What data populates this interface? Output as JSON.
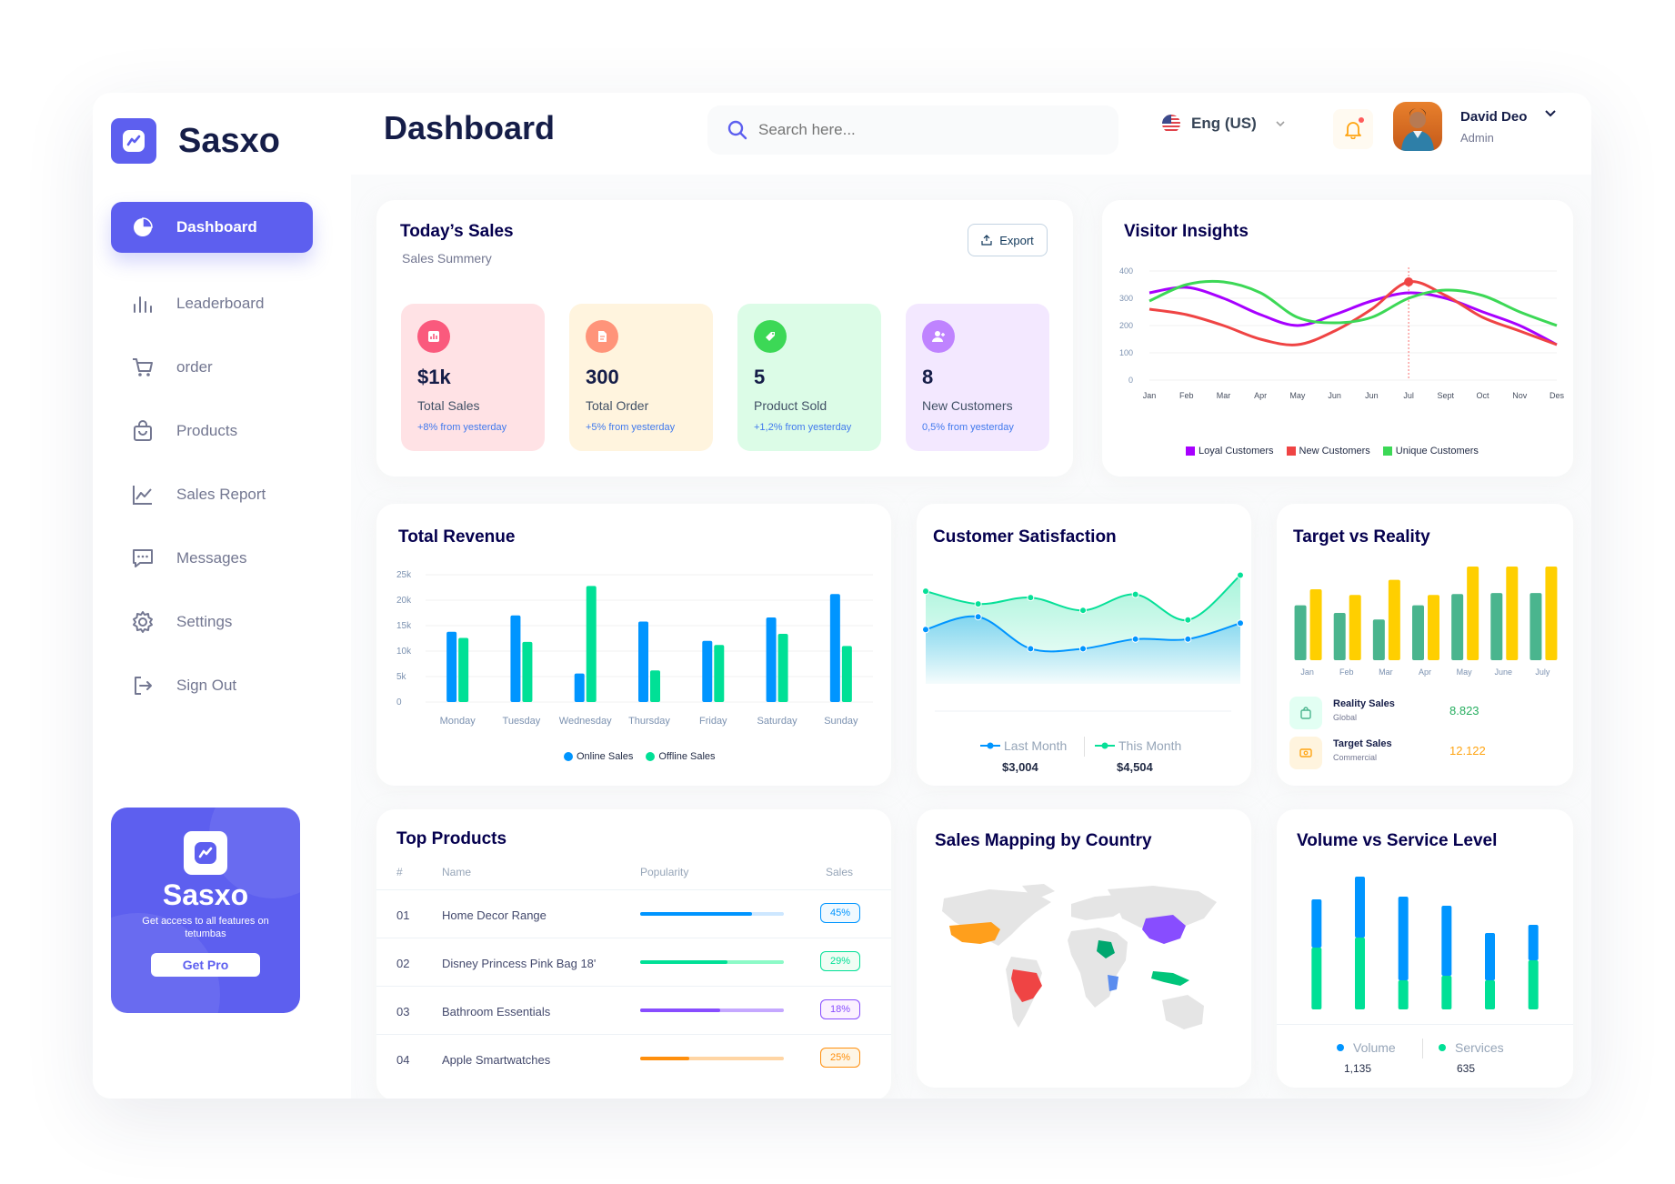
{
  "brand": {
    "name": "Sasxo"
  },
  "header": {
    "title": "Dashboard",
    "search_placeholder": "Search here...",
    "language": "Eng (US)",
    "user_name": "David Deo",
    "user_role": "Admin"
  },
  "sidebar": {
    "items": [
      {
        "label": "Dashboard",
        "icon": "pie-chart-icon",
        "active": true
      },
      {
        "label": "Leaderboard",
        "icon": "bar-chart-icon"
      },
      {
        "label": "order",
        "icon": "cart-icon"
      },
      {
        "label": "Products",
        "icon": "shopping-bag-icon"
      },
      {
        "label": "Sales Report",
        "icon": "line-chart-icon"
      },
      {
        "label": "Messages",
        "icon": "message-icon"
      },
      {
        "label": "Settings",
        "icon": "gear-icon"
      },
      {
        "label": "Sign Out",
        "icon": "sign-out-icon"
      }
    ],
    "promo": {
      "title": "Sasxo",
      "description": "Get access to all features on tetumbas",
      "button": "Get Pro"
    }
  },
  "todays_sales": {
    "title": "Today’s Sales",
    "subtitle": "Sales Summery",
    "export": "Export",
    "stats": [
      {
        "value": "$1k",
        "label": "Total Sales",
        "change": "+8% from yesterday",
        "bg": "#ffe2e5",
        "icon_bg": "#fa5a7d"
      },
      {
        "value": "300",
        "label": "Total Order",
        "change": "+5% from yesterday",
        "bg": "#fff4de",
        "icon_bg": "#ff947a"
      },
      {
        "value": "5",
        "label": "Product Sold",
        "change": "+1,2% from yesterday",
        "bg": "#dcfce7",
        "icon_bg": "#3cd856"
      },
      {
        "value": "8",
        "label": "New Customers",
        "change": "0,5% from yesterday",
        "bg": "#f3e8ff",
        "icon_bg": "#bf83ff"
      }
    ]
  },
  "visitor_insights": {
    "title": "Visitor Insights",
    "chart_data": {
      "type": "line",
      "x": [
        "Jan",
        "Feb",
        "Mar",
        "Apr",
        "May",
        "Jun",
        "Jun",
        "Jul",
        "Sept",
        "Oct",
        "Nov",
        "Des"
      ],
      "ylim": [
        0,
        400
      ],
      "yticks": [
        "400",
        "300",
        "200",
        "100",
        "0"
      ],
      "series": [
        {
          "name": "Loyal Customers",
          "color": "#a700ff",
          "values": [
            320,
            340,
            300,
            240,
            200,
            240,
            290,
            320,
            300,
            250,
            200,
            130
          ]
        },
        {
          "name": "New Customers",
          "color": "#ef4444",
          "values": [
            260,
            240,
            200,
            150,
            130,
            180,
            260,
            360,
            310,
            230,
            180,
            130
          ]
        },
        {
          "name": "Unique Customers",
          "color": "#3cd856",
          "values": [
            290,
            350,
            360,
            320,
            230,
            210,
            230,
            300,
            330,
            310,
            250,
            200
          ]
        }
      ]
    }
  },
  "total_revenue": {
    "title": "Total Revenue",
    "chart_data": {
      "type": "bar",
      "categories": [
        "Monday",
        "Tuesday",
        "Wednesday",
        "Thursday",
        "Friday",
        "Saturday",
        "Sunday"
      ],
      "ylim": [
        0,
        25000
      ],
      "yticks": [
        "25k",
        "20k",
        "15k",
        "10k",
        "5k",
        "0"
      ],
      "series": [
        {
          "name": "Online Sales",
          "color": "#0095ff",
          "values": [
            13800,
            17000,
            5600,
            15800,
            12000,
            16600,
            21200
          ]
        },
        {
          "name": "Offline Sales",
          "color": "#00e096",
          "values": [
            12600,
            11800,
            22800,
            6200,
            11200,
            13400,
            11000
          ]
        }
      ]
    }
  },
  "customer_satisfaction": {
    "title": "Customer Satisfaction",
    "legend_last": "Last Month",
    "legend_this": "This Month",
    "value_last": "$3,004",
    "value_this": "$4,504",
    "chart_data": {
      "type": "area",
      "x": [
        1,
        2,
        3,
        4,
        5,
        6,
        7
      ],
      "series": [
        {
          "name": "Last Month",
          "color": "#0095ff",
          "values": [
            3.2,
            3.6,
            2.6,
            2.6,
            2.9,
            2.9,
            3.4
          ]
        },
        {
          "name": "This Month",
          "color": "#07e098",
          "values": [
            4.4,
            4.0,
            4.2,
            3.8,
            4.3,
            3.5,
            4.9
          ]
        }
      ]
    }
  },
  "target_vs_reality": {
    "title": "Target vs Reality",
    "chart_data": {
      "type": "bar",
      "categories": [
        "Jan",
        "Feb",
        "Mar",
        "Apr",
        "May",
        "June",
        "July"
      ],
      "series": [
        {
          "name": "Reality Sales",
          "color": "#4ab58e",
          "values": [
            58,
            50,
            43,
            58,
            70,
            71,
            71
          ]
        },
        {
          "name": "Target Sales",
          "color": "#ffcf00",
          "values": [
            75,
            69,
            85,
            69,
            99,
            99,
            99
          ]
        }
      ]
    },
    "rows": [
      {
        "title": "Reality Sales",
        "subtitle": "Global",
        "value": "8.823",
        "color": "#27ae60",
        "bg": "#e2fff3"
      },
      {
        "title": "Target Sales",
        "subtitle": "Commercial",
        "value": "12.122",
        "color": "#ffa412",
        "bg": "#fff4de"
      }
    ]
  },
  "top_products": {
    "title": "Top Products",
    "columns": [
      "#",
      "Name",
      "Popularity",
      "Sales"
    ],
    "rows": [
      {
        "num": "01",
        "name": "Home Decor Range",
        "popularity": 0.78,
        "sales": "45%",
        "color": "#0095ff",
        "light": "#cde7ff",
        "badge_bg": "#f0f9ff"
      },
      {
        "num": "02",
        "name": "Disney Princess Pink Bag 18'",
        "popularity": 0.61,
        "sales": "29%",
        "color": "#00e096",
        "light": "#8cfac7",
        "badge_bg": "#f0fdf4"
      },
      {
        "num": "03",
        "name": "Bathroom Essentials",
        "popularity": 0.56,
        "sales": "18%",
        "color": "#884dff",
        "light": "#c5a8ff",
        "badge_bg": "#fbf1ff"
      },
      {
        "num": "04",
        "name": "Apple Smartwatches",
        "popularity": 0.34,
        "sales": "25%",
        "color": "#ff8f0d",
        "light": "#ffd5a4",
        "badge_bg": "#fef6e6"
      }
    ]
  },
  "sales_mapping": {
    "title": "Sales Mapping by Country"
  },
  "volume_service": {
    "title": "Volume vs Service Level",
    "legend_volume": "Volume",
    "legend_services": "Services",
    "value_volume": "1,135",
    "value_services": "635",
    "chart_data": {
      "type": "bar",
      "stacked": true,
      "categories": [
        "1",
        "2",
        "3",
        "4",
        "5",
        "6"
      ],
      "series": [
        {
          "name": "Services",
          "color": "#00e096",
          "values": [
            68,
            79,
            32,
            37,
            32,
            54
          ]
        },
        {
          "name": "Volume",
          "color": "#0095ff",
          "values": [
            53,
            67,
            92,
            77,
            52,
            39
          ]
        }
      ]
    }
  }
}
